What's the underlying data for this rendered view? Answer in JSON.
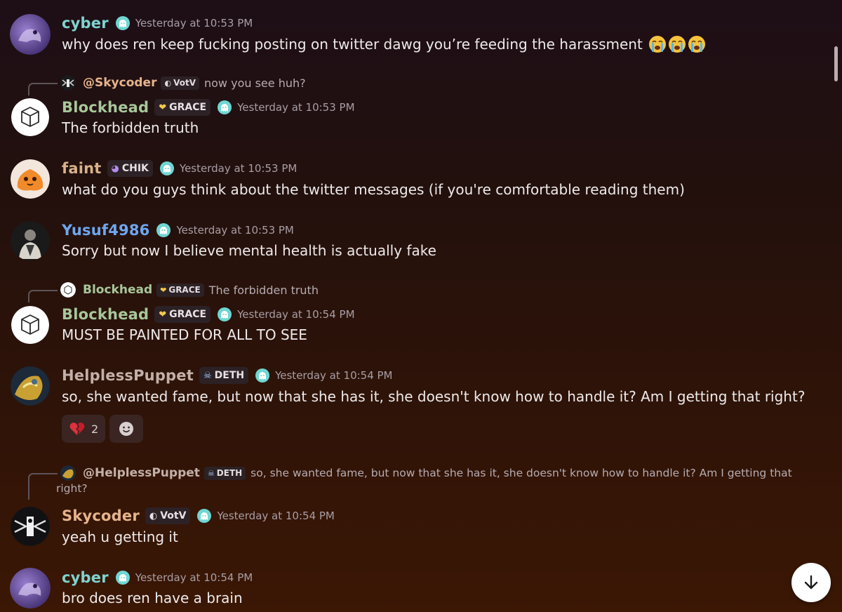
{
  "messages": [
    {
      "author": "cyber",
      "author_color": "#7fd3cf",
      "timestamp": "Yesterday at 10:53 PM",
      "text": "why does ren keep fucking posting on twitter dawg you’re feeding the harassment",
      "emoji": [
        "loudly-crying-face",
        "loudly-crying-face",
        "loudly-crying-face"
      ]
    },
    {
      "reply": {
        "author": "@Skycoder",
        "tag": "VotV",
        "text": "now you see huh?"
      },
      "author": "Blockhead",
      "author_color": "#a8c79a",
      "tag": "GRACE",
      "timestamp": "Yesterday at 10:53 PM",
      "text": "The forbidden truth"
    },
    {
      "author": "faint",
      "author_color": "#d9b28a",
      "tag": "CHIK",
      "timestamp": "Yesterday at 10:53 PM",
      "text": "what do you guys think about  the twitter messages (if you're comfortable reading them)"
    },
    {
      "author": "Yusuf4986",
      "author_color": "#6ea6f0",
      "timestamp": "Yesterday at 10:53 PM",
      "text": "Sorry but now I believe mental health is actually fake"
    },
    {
      "reply": {
        "author": "Blockhead",
        "tag": "GRACE",
        "text": "The forbidden truth"
      },
      "author": "Blockhead",
      "author_color": "#a8c79a",
      "tag": "GRACE",
      "timestamp": "Yesterday at 10:54 PM",
      "text": "MUST BE PAINTED FOR ALL TO SEE"
    },
    {
      "author": "HelplessPuppet",
      "author_color": "#c3b0a8",
      "tag": "DETH",
      "timestamp": "Yesterday at 10:54 PM",
      "text": "so, she wanted fame, but now that she has it, she doesn't know how to handle it? Am I getting that right?",
      "reactions": [
        {
          "emoji": "broken-heart",
          "count": "2"
        }
      ]
    },
    {
      "reply": {
        "author": "@HelplessPuppet",
        "tag": "DETH",
        "text": "so, she wanted fame, but now that she has it, she doesn't know how to handle it? Am I getting that right?"
      },
      "author": "Skycoder",
      "author_color": "#e6b48c",
      "tag": "VotV",
      "timestamp": "Yesterday at 10:54 PM",
      "text": "yeah u getting it"
    },
    {
      "author": "cyber",
      "author_color": "#7fd3cf",
      "timestamp": "Yesterday at 10:54 PM",
      "text": "bro does ren have a brain"
    }
  ],
  "reply_wrap": {
    "line1": "so, she wanted fame, but now that she has it, she doesn't know how to handle it? Am I getting that",
    "line2": "right?"
  },
  "colors": {
    "nitro": "#6fd6d2",
    "timestamp": "#a89ea5",
    "tag_bg": "#2c2226"
  },
  "icons": [
    "nitro-ghost-icon",
    "scroll-to-bottom-arrow-icon",
    "add-reaction-icon"
  ]
}
